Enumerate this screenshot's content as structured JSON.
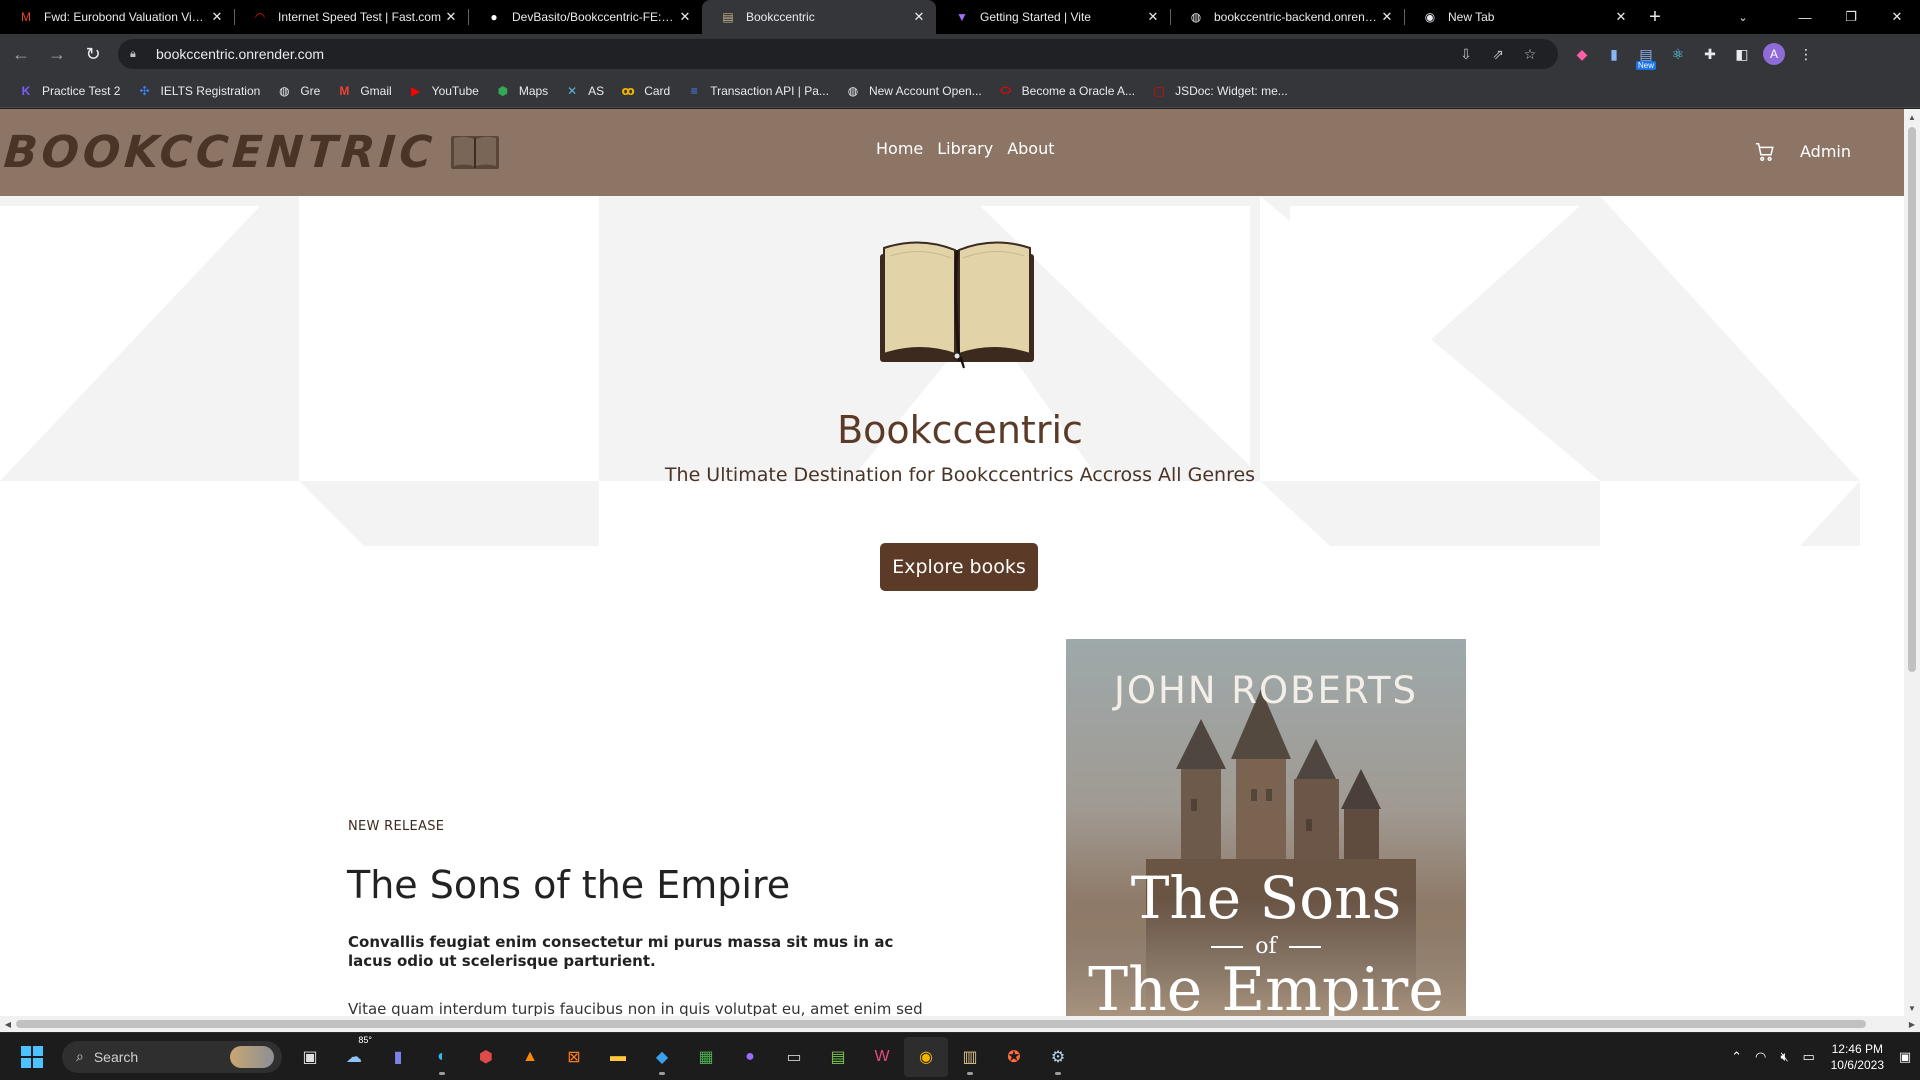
{
  "browser": {
    "tabs": [
      {
        "title": "Fwd: Eurobond Valuation View -",
        "icon": "gmail-icon",
        "glyph": "M",
        "color": "#ea4335",
        "active": false
      },
      {
        "title": "Internet Speed Test | Fast.com",
        "icon": "fast-icon",
        "glyph": "◠",
        "color": "#e50914",
        "active": false
      },
      {
        "title": "DevBasito/Bookccentric-FE: An",
        "icon": "github-icon",
        "glyph": "●",
        "color": "#ffffff",
        "active": false
      },
      {
        "title": "Bookccentric",
        "icon": "book-icon",
        "glyph": "▤",
        "color": "#c8b48a",
        "active": true
      },
      {
        "title": "Getting Started | Vite",
        "icon": "vite-icon",
        "glyph": "▼",
        "color": "#a46bff",
        "active": false
      },
      {
        "title": "bookccentric-backend.onrender",
        "icon": "globe-icon",
        "glyph": "◍",
        "color": "#e8eaed",
        "active": false
      },
      {
        "title": "New Tab",
        "icon": "chrome-icon",
        "glyph": "◉",
        "color": "#e8eaed",
        "active": false
      }
    ],
    "new_tab_glyph": "+",
    "url": "bookccentric.onrender.com",
    "profile_initial": "A",
    "new_badge": "New",
    "bookmarks": [
      {
        "label": "Practice Test 2",
        "icon": "k-icon",
        "glyph": "K",
        "color": "#7b5cff"
      },
      {
        "label": "IELTS Registration",
        "icon": "grid-icon",
        "glyph": "✣",
        "color": "#3b82f6"
      },
      {
        "label": "Gre",
        "icon": "globe-icon",
        "glyph": "◍",
        "color": "#e8eaed"
      },
      {
        "label": "Gmail",
        "icon": "gmail-icon",
        "glyph": "M",
        "color": "#ea4335"
      },
      {
        "label": "YouTube",
        "icon": "youtube-icon",
        "glyph": "▶",
        "color": "#ff0000"
      },
      {
        "label": "Maps",
        "icon": "maps-icon",
        "glyph": "⬢",
        "color": "#34a853"
      },
      {
        "label": "AS",
        "icon": "as-icon",
        "glyph": "✕",
        "color": "#5ab4d6"
      },
      {
        "label": "Card",
        "icon": "card-icon",
        "glyph": "ꝏ",
        "color": "#f4b400"
      },
      {
        "label": "Transaction API | Pa...",
        "icon": "docs-icon",
        "glyph": "≡",
        "color": "#4285f4"
      },
      {
        "label": "New Account Open...",
        "icon": "globe-icon",
        "glyph": "◍",
        "color": "#e8eaed"
      },
      {
        "label": "Become a Oracle A...",
        "icon": "oracle-icon",
        "glyph": "⬭",
        "color": "#f80000"
      },
      {
        "label": "JSDoc: Widget: me...",
        "icon": "oracle-square-icon",
        "glyph": "▢",
        "color": "#f80000"
      }
    ]
  },
  "site": {
    "logo_text": "BOOKCCENTRIC",
    "nav": [
      "Home",
      "Library",
      "About"
    ],
    "admin_label": "Admin",
    "hero_title": "Bookccentric",
    "hero_subtitle": "The Ultimate Destination for Bookccentrics Accross All Genres",
    "cta": "Explore books",
    "release_label": "NEW RELEASE",
    "release_title": "The Sons of the Empire",
    "release_desc": "Convallis feugiat enim consectetur mi purus massa sit mus in ac lacus odio ut scelerisque parturient.",
    "release_body": "Vitae quam interdum turpis faucibus non in quis volutpat eu, amet enim sed mattis",
    "cover": {
      "author": "JOHN ROBERTS",
      "title_line1": "The Sons",
      "title_of": "of",
      "title_line2": "The Empire"
    },
    "colors": {
      "nav_bg": "#8d7566",
      "brown": "#5b3a28",
      "logo": "#4a3426"
    }
  },
  "taskbar": {
    "search_label": "Search",
    "weather_temp": "85°",
    "apps": [
      {
        "name": "task-view-icon",
        "glyph": "▣",
        "color": "#e0e0e0"
      },
      {
        "name": "weather-icon",
        "glyph": "☁",
        "color": "#8fc4ff"
      },
      {
        "name": "teams-icon",
        "glyph": "▮",
        "color": "#7b83eb"
      },
      {
        "name": "edge-icon",
        "glyph": "◐",
        "color": "#36b6e8",
        "running": true
      },
      {
        "name": "security-icon",
        "glyph": "⬢",
        "color": "#e04a4a"
      },
      {
        "name": "vlc-icon",
        "glyph": "▲",
        "color": "#ff8800"
      },
      {
        "name": "xampp-icon",
        "glyph": "⊠",
        "color": "#fb7a24"
      },
      {
        "name": "file-explorer-icon",
        "glyph": "▬",
        "color": "#ffc83d"
      },
      {
        "name": "vscode-icon",
        "glyph": "◆",
        "color": "#3aa2ec",
        "running": true
      },
      {
        "name": "app-store-icon",
        "glyph": "▦",
        "color": "#4caf50"
      },
      {
        "name": "github-desktop-icon",
        "glyph": "●",
        "color": "#9b6bff"
      },
      {
        "name": "terminal-icon",
        "glyph": "▭",
        "color": "#cfcfcf"
      },
      {
        "name": "notepad-icon",
        "glyph": "▤",
        "color": "#7ac74f"
      },
      {
        "name": "wps-icon",
        "glyph": "W",
        "color": "#e54c7e"
      },
      {
        "name": "chrome-icon",
        "glyph": "◉",
        "color": "#f4b400",
        "active": true
      },
      {
        "name": "book-app-icon",
        "glyph": "▥",
        "color": "#d9c08a",
        "running": true
      },
      {
        "name": "postman-icon",
        "glyph": "✪",
        "color": "#ff6c37"
      },
      {
        "name": "settings-icon",
        "glyph": "⚙",
        "color": "#bcd3e8",
        "running": true
      }
    ],
    "time": "12:46 PM",
    "date": "10/6/2023"
  }
}
